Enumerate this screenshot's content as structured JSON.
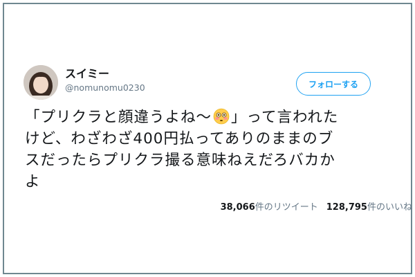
{
  "user": {
    "display_name": "スイミー",
    "handle": "@nomunomu0230"
  },
  "follow_button": {
    "label": "フォローする"
  },
  "tweet": {
    "line1_a": "「プリクラと顔違うよね〜",
    "emoji": "flushed-face-emoji",
    "line1_b": "」って言われた",
    "line2": "けど、わざわざ400円払ってありのままのブ",
    "line3": "スだったらプリクラ撮る意味ねえだろバカか",
    "line4": "よ"
  },
  "stats": {
    "retweets_count": "38,066",
    "retweets_label": "件のリツイート",
    "likes_count": "128,795",
    "likes_label": "件のいいね"
  },
  "colors": {
    "accent": "#1da1f2",
    "frame": "#6f8790",
    "text": "#14171a",
    "muted": "#657786"
  }
}
